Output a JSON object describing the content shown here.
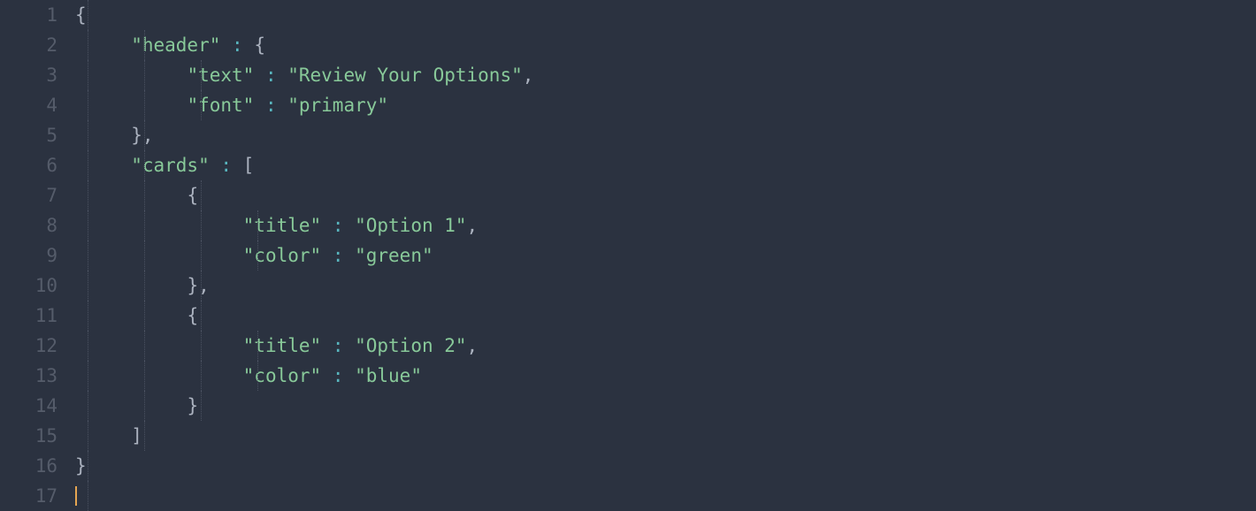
{
  "lineNumbers": [
    "1",
    "2",
    "3",
    "4",
    "5",
    "6",
    "7",
    "8",
    "9",
    "10",
    "11",
    "12",
    "13",
    "14",
    "15",
    "16",
    "17"
  ],
  "lines": {
    "l1": {
      "open_brace": "{"
    },
    "l2": {
      "key": "\"header\"",
      "colon": " : ",
      "open_brace": "{"
    },
    "l3": {
      "key": "\"text\"",
      "colon": " : ",
      "value": "\"Review Your Options\"",
      "comma": ","
    },
    "l4": {
      "key": "\"font\"",
      "colon": " : ",
      "value": "\"primary\""
    },
    "l5": {
      "close_brace": "}",
      "comma": ","
    },
    "l6": {
      "key": "\"cards\"",
      "colon": " : ",
      "open_bracket": "["
    },
    "l7": {
      "open_brace": "{"
    },
    "l8": {
      "key": "\"title\"",
      "colon": " : ",
      "value": "\"Option 1\"",
      "comma": ","
    },
    "l9": {
      "key": "\"color\"",
      "colon": " : ",
      "value": "\"green\""
    },
    "l10": {
      "close_brace": "}",
      "comma": ","
    },
    "l11": {
      "open_brace": "{"
    },
    "l12": {
      "key": "\"title\"",
      "colon": " : ",
      "value": "\"Option 2\"",
      "comma": ","
    },
    "l13": {
      "key": "\"color\"",
      "colon": " : ",
      "value": "\"blue\""
    },
    "l14": {
      "close_brace": "}"
    },
    "l15": {
      "close_bracket": "]"
    },
    "l16": {
      "close_brace": "}"
    }
  }
}
